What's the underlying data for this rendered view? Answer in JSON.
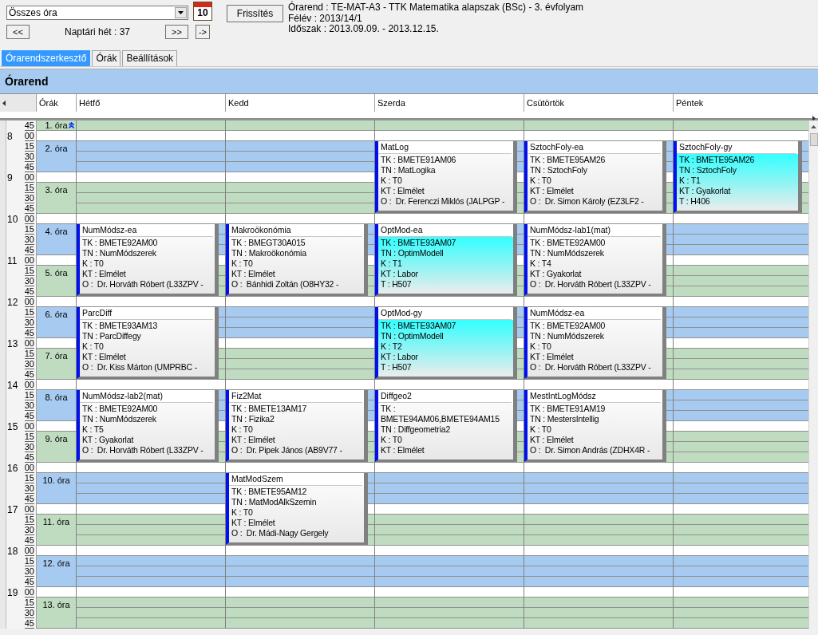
{
  "toolbar": {
    "filter": {
      "value": "Összes óra"
    },
    "calendar_day": "10",
    "refresh_button": "Frissítés",
    "prev_button": "<<",
    "week_label": "Naptári hét : 37",
    "next_button": ">>",
    "go_button": "->"
  },
  "info": [
    "Órarend : TE-MAT-A3 - TTK Matematika alapszak (BSc) - 3. évfolyam",
    "Félév : 2013/14/1",
    "Időszak : 2013.09.09. - 2013.12.15."
  ],
  "tabs": [
    {
      "label": "Órarendszerkesztő",
      "selected": true
    },
    {
      "label": "Órák",
      "selected": false
    },
    {
      "label": "Beállítások",
      "selected": false
    }
  ],
  "panel": {
    "title": "Órarend"
  },
  "timetable": {
    "periods_heading": "Órák",
    "days": [
      "Hétfő",
      "Kedd",
      "Szerda",
      "Csütörtök",
      "Péntek"
    ],
    "times": [
      {
        "minute": "45"
      },
      {
        "hour": "8",
        "minute": "00"
      },
      {
        "minute": "15"
      },
      {
        "minute": "30"
      },
      {
        "minute": "45"
      },
      {
        "hour": "9",
        "minute": "00"
      },
      {
        "minute": "15"
      },
      {
        "minute": "30"
      },
      {
        "minute": "45"
      },
      {
        "hour": "10",
        "minute": "00"
      },
      {
        "minute": "15"
      },
      {
        "minute": "30"
      },
      {
        "minute": "45"
      },
      {
        "hour": "11",
        "minute": "00"
      },
      {
        "minute": "15"
      },
      {
        "minute": "30"
      },
      {
        "minute": "45"
      },
      {
        "hour": "12",
        "minute": "00"
      },
      {
        "minute": "15"
      },
      {
        "minute": "30"
      },
      {
        "minute": "45"
      },
      {
        "hour": "13",
        "minute": "00"
      },
      {
        "minute": "15"
      },
      {
        "minute": "30"
      },
      {
        "minute": "45"
      },
      {
        "hour": "14",
        "minute": "00"
      },
      {
        "minute": "15"
      },
      {
        "minute": "30"
      },
      {
        "minute": "45"
      },
      {
        "hour": "15",
        "minute": "00"
      },
      {
        "minute": "15"
      },
      {
        "minute": "30"
      },
      {
        "minute": "45"
      },
      {
        "hour": "16",
        "minute": "00"
      },
      {
        "minute": "15"
      },
      {
        "minute": "30"
      },
      {
        "minute": "45"
      },
      {
        "hour": "17",
        "minute": "00"
      },
      {
        "minute": "15"
      },
      {
        "minute": "30"
      },
      {
        "minute": "45"
      },
      {
        "hour": "18",
        "minute": "00"
      },
      {
        "minute": "15"
      },
      {
        "minute": "30"
      },
      {
        "minute": "45"
      },
      {
        "hour": "19",
        "minute": "00"
      },
      {
        "minute": "15"
      },
      {
        "minute": "30"
      },
      {
        "minute": "45"
      }
    ],
    "periods": [
      {
        "label": "1. óra",
        "cells": [
          {
            "kind": "free"
          },
          {
            "kind": "free"
          },
          {
            "kind": "free"
          },
          {
            "kind": "free"
          },
          {
            "kind": "free"
          }
        ]
      },
      {
        "label": "2. óra",
        "cells": [
          {
            "kind": "free"
          },
          {
            "kind": "free"
          },
          {
            "kind": "course",
            "title": "MatLog",
            "highlighted": false,
            "lines": [
              "TK : BMETE91AM06",
              "TN : MatLogika",
              "K : T0",
              "KT : Elmélet",
              "O :  Dr. Ferenczi Miklós (JALPGP -"
            ]
          },
          {
            "kind": "course",
            "title": "SztochFoly-ea",
            "highlighted": false,
            "lines": [
              "TK : BMETE95AM26",
              "TN : SztochFoly",
              "K : T0",
              "KT : Elmélet",
              "O :  Dr. Simon Károly (EZ3LF2 -"
            ]
          },
          {
            "kind": "course",
            "title": "SztochFoly-gy",
            "highlighted": true,
            "lines": [
              "TK : BMETE95AM26",
              "TN : SztochFoly",
              "K : T1",
              "KT : Gyakorlat",
              "T : H406"
            ]
          }
        ]
      },
      {
        "label": "3. óra",
        "cells": [
          {
            "kind": "free"
          },
          {
            "kind": "free"
          },
          {
            "kind": "free"
          },
          {
            "kind": "free"
          },
          {
            "kind": "free"
          }
        ]
      },
      {
        "label": "4. óra",
        "cells": [
          {
            "kind": "course",
            "title": "NumMódsz-ea",
            "highlighted": false,
            "lines": [
              "TK : BMETE92AM00",
              "TN : NumMódszerek",
              "K : T0",
              "KT : Elmélet",
              "O :  Dr. Horváth Róbert (L33ZPV -"
            ]
          },
          {
            "kind": "course",
            "title": "Makroökonómia",
            "highlighted": false,
            "lines": [
              "TK : BMEGT30A015",
              "TN : Makroökonómia",
              "K : T0",
              "KT : Elmélet",
              "O :  Bánhidi Zoltán (O8HY32 -"
            ]
          },
          {
            "kind": "course",
            "title": "OptMod-ea",
            "highlighted": true,
            "lines": [
              "TK : BMETE93AM07",
              "TN : OptimModell",
              "K : T1",
              "KT : Labor",
              "T : H507"
            ]
          },
          {
            "kind": "course",
            "title": "NumMódsz-lab1(mat)",
            "highlighted": false,
            "lines": [
              "TK : BMETE92AM00",
              "TN : NumMódszerek",
              "K : T4",
              "KT : Gyakorlat",
              "O :  Dr. Horváth Róbert (L33ZPV -"
            ]
          },
          {
            "kind": "free"
          }
        ]
      },
      {
        "label": "5. óra",
        "cells": [
          {
            "kind": "free"
          },
          {
            "kind": "free"
          },
          {
            "kind": "free"
          },
          {
            "kind": "free"
          },
          {
            "kind": "free"
          }
        ]
      },
      {
        "label": "6. óra",
        "cells": [
          {
            "kind": "course",
            "title": "ParcDiff",
            "highlighted": false,
            "lines": [
              "TK : BMETE93AM13",
              "TN : ParcDiffegy",
              "K : T0",
              "KT : Elmélet",
              "O :  Dr. Kiss Márton (UMPRBC -"
            ]
          },
          {
            "kind": "free"
          },
          {
            "kind": "course",
            "title": "OptMod-gy",
            "highlighted": true,
            "lines": [
              "TK : BMETE93AM07",
              "TN : OptimModell",
              "K : T2",
              "KT : Labor",
              "T : H507"
            ]
          },
          {
            "kind": "course",
            "title": "NumMódsz-ea",
            "highlighted": false,
            "lines": [
              "TK : BMETE92AM00",
              "TN : NumMódszerek",
              "K : T0",
              "KT : Elmélet",
              "O :  Dr. Horváth Róbert (L33ZPV -"
            ]
          },
          {
            "kind": "free"
          }
        ]
      },
      {
        "label": "7. óra",
        "cells": [
          {
            "kind": "free"
          },
          {
            "kind": "free"
          },
          {
            "kind": "free"
          },
          {
            "kind": "free"
          },
          {
            "kind": "free"
          }
        ]
      },
      {
        "label": "8. óra",
        "cells": [
          {
            "kind": "course",
            "title": "NumMódsz-lab2(mat)",
            "highlighted": false,
            "lines": [
              "TK : BMETE92AM00",
              "TN : NumMódszerek",
              "K : T5",
              "KT : Gyakorlat",
              "O :  Dr. Horváth Róbert (L33ZPV -"
            ]
          },
          {
            "kind": "course",
            "title": "Fiz2Mat",
            "highlighted": false,
            "lines": [
              "TK : BMETE13AM17",
              "TN : Fizika2",
              "K : T0",
              "KT : Elmélet",
              "O :  Dr. Pipek János (AB9V77 -"
            ]
          },
          {
            "kind": "course",
            "title": "Diffgeo2",
            "highlighted": false,
            "lines": [
              "TK : BMETE94AM06,BMETE94AM15",
              "TN : Diffgeometria2",
              "K : T0",
              "KT : Elmélet"
            ]
          },
          {
            "kind": "course",
            "title": "MestIntLogMódsz",
            "highlighted": false,
            "lines": [
              "TK : BMETE91AM19",
              "TN : MestersIntellig",
              "K : T0",
              "KT : Elmélet",
              "O :  Dr. Simon András (ZDHX4R -"
            ]
          },
          {
            "kind": "free"
          }
        ]
      },
      {
        "label": "9. óra",
        "cells": [
          {
            "kind": "free"
          },
          {
            "kind": "free"
          },
          {
            "kind": "free"
          },
          {
            "kind": "free"
          },
          {
            "kind": "free"
          }
        ]
      },
      {
        "label": "10. óra",
        "cells": [
          {
            "kind": "free"
          },
          {
            "kind": "course",
            "title": "MatModSzem",
            "highlighted": false,
            "lines": [
              "TK : BMETE95AM12",
              "TN : MatModAlkSzemin",
              "K : T0",
              "KT : Elmélet",
              "O :  Dr. Mádi-Nagy Gergely"
            ]
          },
          {
            "kind": "free"
          },
          {
            "kind": "free"
          },
          {
            "kind": "free"
          }
        ]
      },
      {
        "label": "11. óra",
        "cells": [
          {
            "kind": "free"
          },
          {
            "kind": "free"
          },
          {
            "kind": "free"
          },
          {
            "kind": "free"
          },
          {
            "kind": "free"
          }
        ]
      },
      {
        "label": "12. óra",
        "cells": [
          {
            "kind": "free"
          },
          {
            "kind": "free"
          },
          {
            "kind": "free"
          },
          {
            "kind": "free"
          },
          {
            "kind": "free"
          }
        ]
      },
      {
        "label": "13. óra",
        "cells": [
          {
            "kind": "free"
          },
          {
            "kind": "free"
          },
          {
            "kind": "free"
          },
          {
            "kind": "free"
          },
          {
            "kind": "free"
          }
        ]
      }
    ]
  }
}
